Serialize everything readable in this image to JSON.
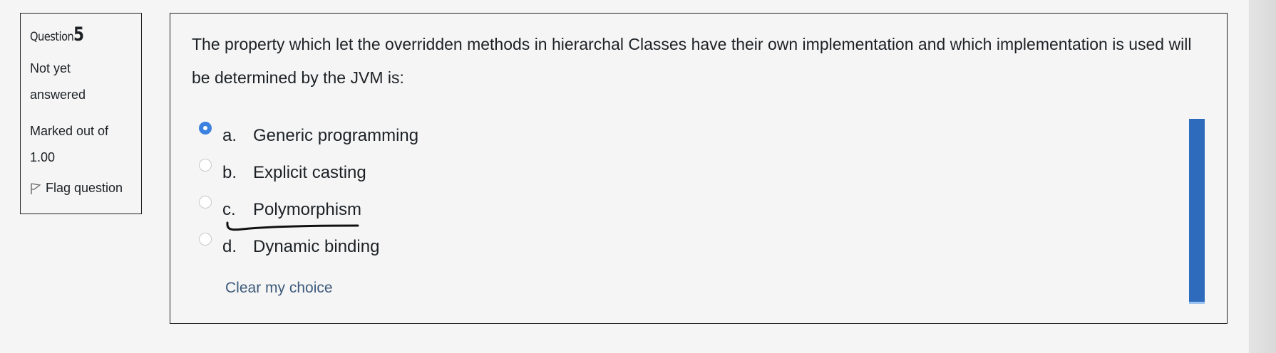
{
  "info": {
    "question_word": "Question",
    "question_number": "5",
    "status_line1": "Not yet",
    "status_line2": "answered",
    "marked_line1": "Marked out of",
    "marked_line2": "1.00",
    "flag_label": "Flag question"
  },
  "question": {
    "text": "The property which let the overridden methods in hierarchal Classes have their own implementation and which implementation is used will be determined by the JVM is:"
  },
  "answers": [
    {
      "letter": "a.",
      "label": "Generic programming",
      "selected": true
    },
    {
      "letter": "b.",
      "label": "Explicit casting",
      "selected": false
    },
    {
      "letter": "c.",
      "label": "Polymorphism",
      "selected": false
    },
    {
      "letter": "d.",
      "label": "Dynamic binding",
      "selected": false
    }
  ],
  "clear_choice_label": "Clear my choice",
  "colors": {
    "selected_radio": "#3b82e0",
    "scroll_indicator": "#2f6bbd",
    "link": "#3d5a7a"
  }
}
